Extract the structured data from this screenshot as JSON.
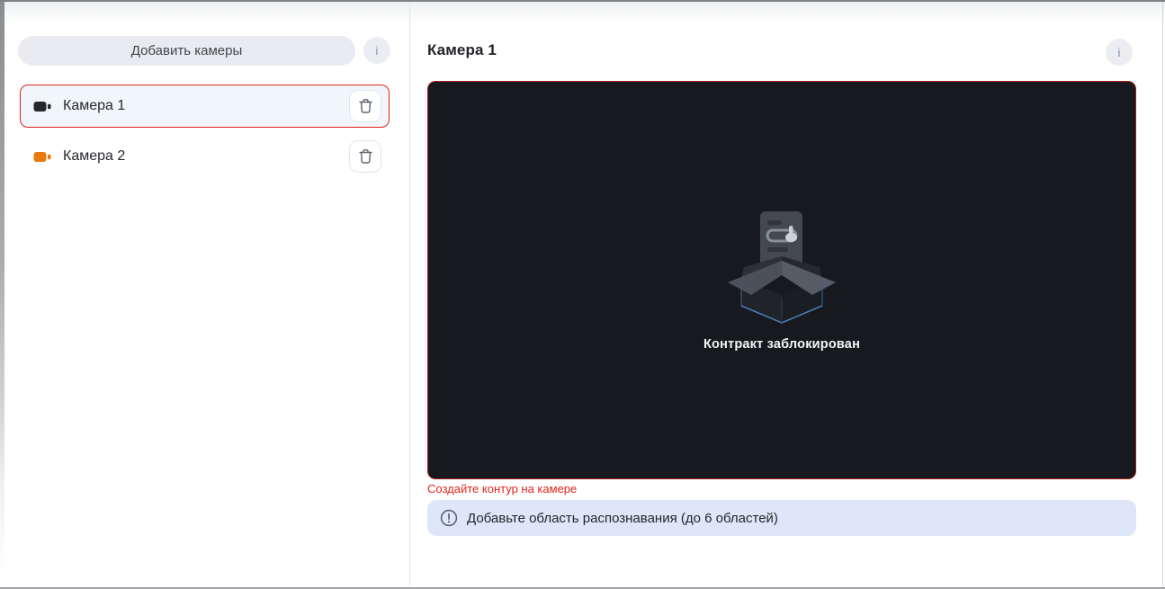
{
  "colors": {
    "accent_red": "#e0241b",
    "video_border_red": "#a81d16",
    "selected_row_bg": "#f1f5fc",
    "info_banner_bg": "#dde7f9",
    "video_bg": "#17191e",
    "add_button_bg": "#e9ebf1",
    "camera1_icon_color": "#26282d",
    "camera2_icon_color": "#e8790f"
  },
  "sidebar": {
    "add_cameras_button": "Добавить камеры",
    "info_button": "i",
    "cameras": [
      {
        "label": "Камера 1",
        "icon_color": "#26282d",
        "selected": true
      },
      {
        "label": "Камера 2",
        "icon_color": "#e8790f",
        "selected": false
      }
    ]
  },
  "main": {
    "title": "Камера 1",
    "info_button": "i",
    "video_placeholder": {
      "illustration": "empty-open-box",
      "status_text": "Контракт заблокирован"
    },
    "validation_error": "Создайте контур на камере",
    "info_banner": {
      "icon": "circle-exclamation",
      "text": "Добавьте область распознавания (до 6 областей)"
    }
  }
}
